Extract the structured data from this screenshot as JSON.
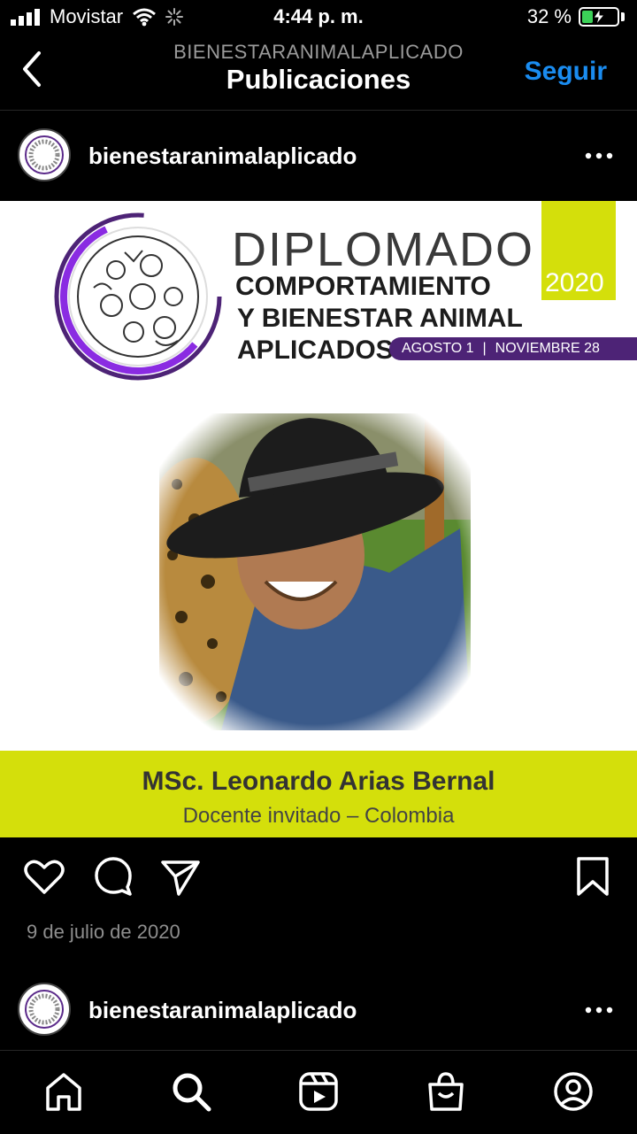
{
  "status": {
    "carrier": "Movistar",
    "time": "4:44 p. m.",
    "battery_text": "32 %",
    "battery_level": 0.32,
    "accent": "#3cd158"
  },
  "nav": {
    "subtitle": "BIENESTARANIMALAPLICADO",
    "title": "Publicaciones",
    "follow_label": "Seguir",
    "follow_color": "#1a8cf0"
  },
  "post": {
    "username": "bienestaranimalaplicado",
    "banner": {
      "line1": "DIPLOMADO",
      "line2": "COMPORTAMIENTO",
      "line3": "Y BIENESTAR ANIMAL",
      "line4": "APLICADOS",
      "year": "2020",
      "date_start": "AGOSTO 1",
      "date_sep": "|",
      "date_end": "NOVIEMBRE 28"
    },
    "caption_name": "MSc. Leonardo Arias Bernal",
    "caption_role": "Docente invitado – Colombia",
    "date": "9 de julio de 2020"
  },
  "next_post": {
    "username": "bienestaranimalaplicado"
  },
  "icons": {
    "actions": [
      "heart-icon",
      "comment-icon",
      "share-icon",
      "bookmark-icon"
    ],
    "tabs": [
      "home-icon",
      "search-icon",
      "reels-icon",
      "shop-icon",
      "profile-icon"
    ]
  }
}
